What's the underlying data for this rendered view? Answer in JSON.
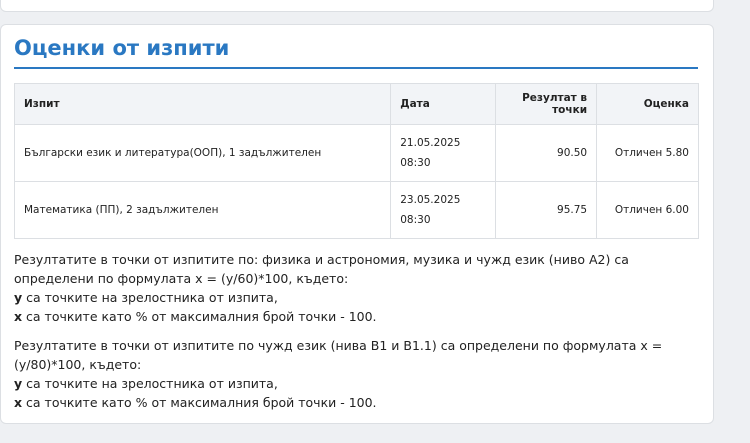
{
  "section": {
    "title": "Оценки от изпити"
  },
  "table": {
    "headers": {
      "exam": "Изпит",
      "date": "Дата",
      "score": "Резултат в точки",
      "grade": "Оценка"
    },
    "rows": [
      {
        "exam": "Български език и литература(ООП), 1 задължителен",
        "date": "21.05.2025",
        "time": "08:30",
        "score": "90.50",
        "grade": "Отличен 5.80"
      },
      {
        "exam": "Математика (ПП), 2 задължителен",
        "date": "23.05.2025",
        "time": "08:30",
        "score": "95.75",
        "grade": "Отличен 6.00"
      }
    ]
  },
  "notes": {
    "note1": {
      "intro": "Резултатите в точки от изпитите по: физика и астрономия, музика и чужд език (ниво А2) са определени по формулата x = (y/60)*100, където:",
      "y_var": "y",
      "y_text": " са точките на зрелостника от изпита,",
      "x_var": "x",
      "x_text": " са точките като % от максималния брой точки - 100."
    },
    "note2": {
      "intro": "Резултатите в точки от изпитите по чужд език (нива B1 и B1.1) са определени по формулата x = (y/80)*100, където:",
      "y_var": "y",
      "y_text": " са точките на зрелостника от изпита,",
      "x_var": "x",
      "x_text": " са точките като % от максималния брой точки - 100."
    }
  }
}
